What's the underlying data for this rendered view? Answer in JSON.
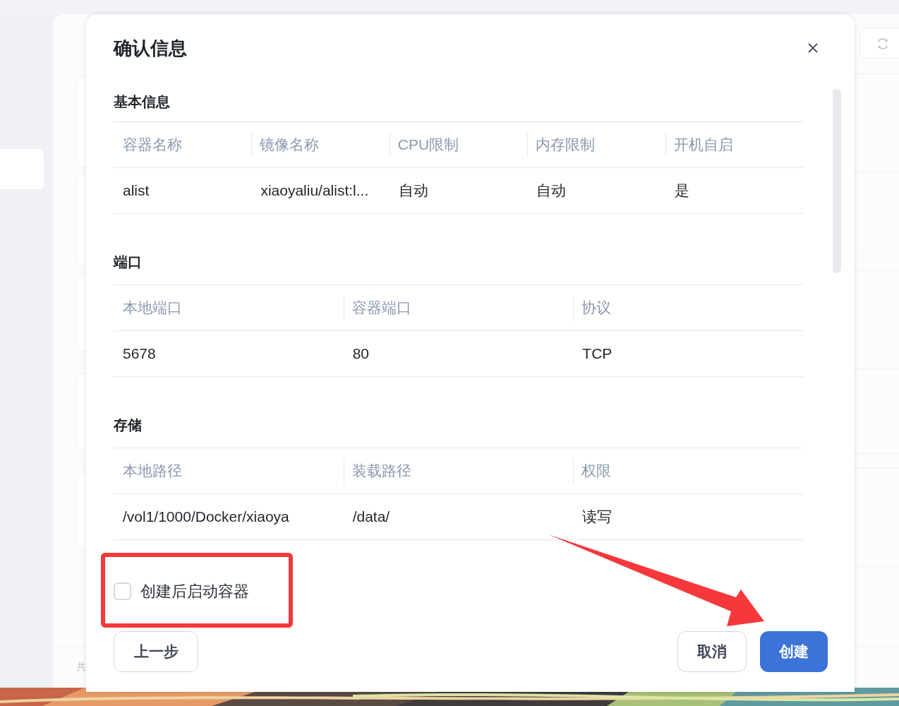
{
  "background": {
    "footer_fragment": "共"
  },
  "dialog": {
    "title": "确认信息",
    "sections": [
      {
        "heading": "基本信息",
        "columns": [
          "容器名称",
          "镜像名称",
          "CPU限制",
          "内存限制",
          "开机自启"
        ],
        "rows": [
          [
            "alist",
            "xiaoyaliu/alist:l...",
            "自动",
            "自动",
            "是"
          ]
        ]
      },
      {
        "heading": "端口",
        "columns": [
          "本地端口",
          "容器端口",
          "协议"
        ],
        "rows": [
          [
            "5678",
            "80",
            "TCP"
          ]
        ]
      },
      {
        "heading": "存储",
        "columns": [
          "本地路径",
          "装载路径",
          "权限"
        ],
        "rows": [
          [
            "/vol1/1000/Docker/xiaoya",
            "/data/",
            "读写"
          ]
        ]
      }
    ],
    "start_after_create": {
      "label": "创建后启动容器",
      "checked": false
    },
    "buttons": [
      {
        "label": "上一步",
        "kind": "back"
      },
      {
        "label": "取消",
        "kind": "secondary"
      },
      {
        "label": "创建",
        "kind": "primary"
      }
    ]
  }
}
